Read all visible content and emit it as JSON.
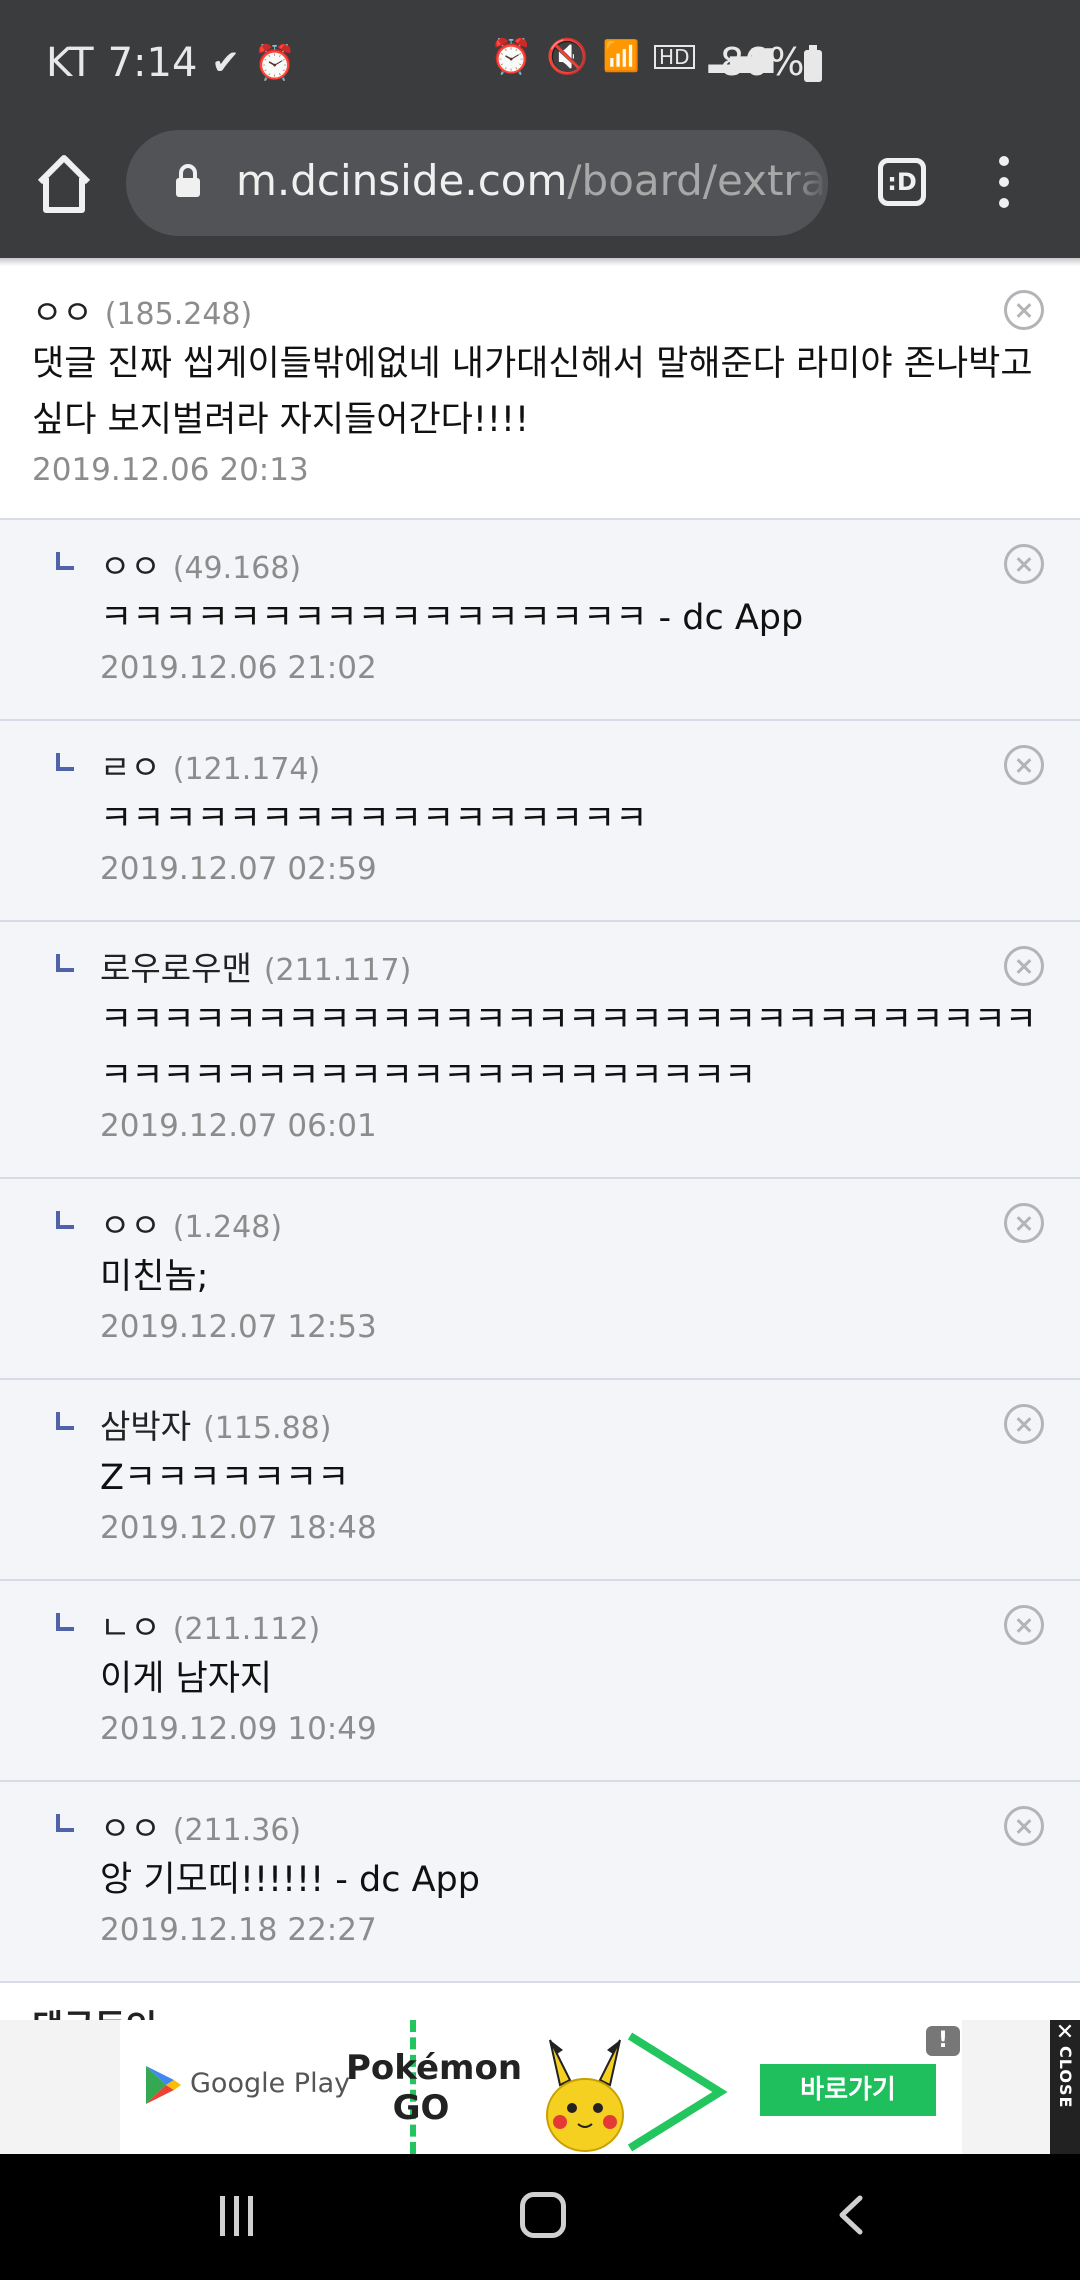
{
  "status": {
    "carrier": "KT",
    "time": "7:14",
    "battery_pct": "86%"
  },
  "browser": {
    "url_host": "m.dcinside.com",
    "url_path": "/board/extra",
    "tabs_label": ":D"
  },
  "comments": [
    {
      "type": "top",
      "name": "ㅇㅇ",
      "ip": "(185.248)",
      "text": "댓글 진짜 씹게이들밖에없네 내가대신해서 말해준다 라미야 존나박고싶다 보지벌려라 자지들어간다!!!!",
      "date": "2019.12.06 20:13"
    },
    {
      "type": "reply",
      "name": "ㅇㅇ",
      "ip": "(49.168)",
      "text": "ㅋㅋㅋㅋㅋㅋㅋㅋㅋㅋㅋㅋㅋㅋㅋㅋㅋ - dc App",
      "date": "2019.12.06 21:02"
    },
    {
      "type": "reply",
      "name": "ㄹㅇ",
      "ip": "(121.174)",
      "text": "ㅋㅋㅋㅋㅋㅋㅋㅋㅋㅋㅋㅋㅋㅋㅋㅋㅋ",
      "date": "2019.12.07 02:59"
    },
    {
      "type": "reply",
      "name": "로우로우맨",
      "ip": "(211.117)",
      "text": "ㅋㅋㅋㅋㅋㅋㅋㅋㅋㅋㅋㅋㅋㅋㅋㅋㅋㅋㅋㅋㅋㅋㅋㅋㅋㅋㅋㅋㅋㅋㅋㅋㅋㅋㅋㅋㅋㅋㅋㅋㅋㅋㅋㅋㅋㅋㅋㅋㅋㅋㅋ",
      "date": "2019.12.07 06:01"
    },
    {
      "type": "reply",
      "name": "ㅇㅇ",
      "ip": "(1.248)",
      "text": "미친놈;",
      "date": "2019.12.07 12:53"
    },
    {
      "type": "reply",
      "name": "삼박자",
      "ip": "(115.88)",
      "text": "Zㅋㅋㅋㅋㅋㅋㅋ",
      "date": "2019.12.07 18:48"
    },
    {
      "type": "reply",
      "name": "ㄴㅇ",
      "ip": "(211.112)",
      "text": "이게 남자지",
      "date": "2019.12.09 10:49"
    },
    {
      "type": "reply",
      "name": "ㅇㅇ",
      "ip": "(211.36)",
      "text": "앙 기모띠!!!!!! - dc App",
      "date": "2019.12.18 22:27"
    }
  ],
  "section_partial_label": "댓글등인",
  "ad": {
    "store_label": "Google Play",
    "game_title": "Pokémon GO",
    "cta_label": "바로가기",
    "info_label": "!",
    "close_label": "CLOSE"
  }
}
